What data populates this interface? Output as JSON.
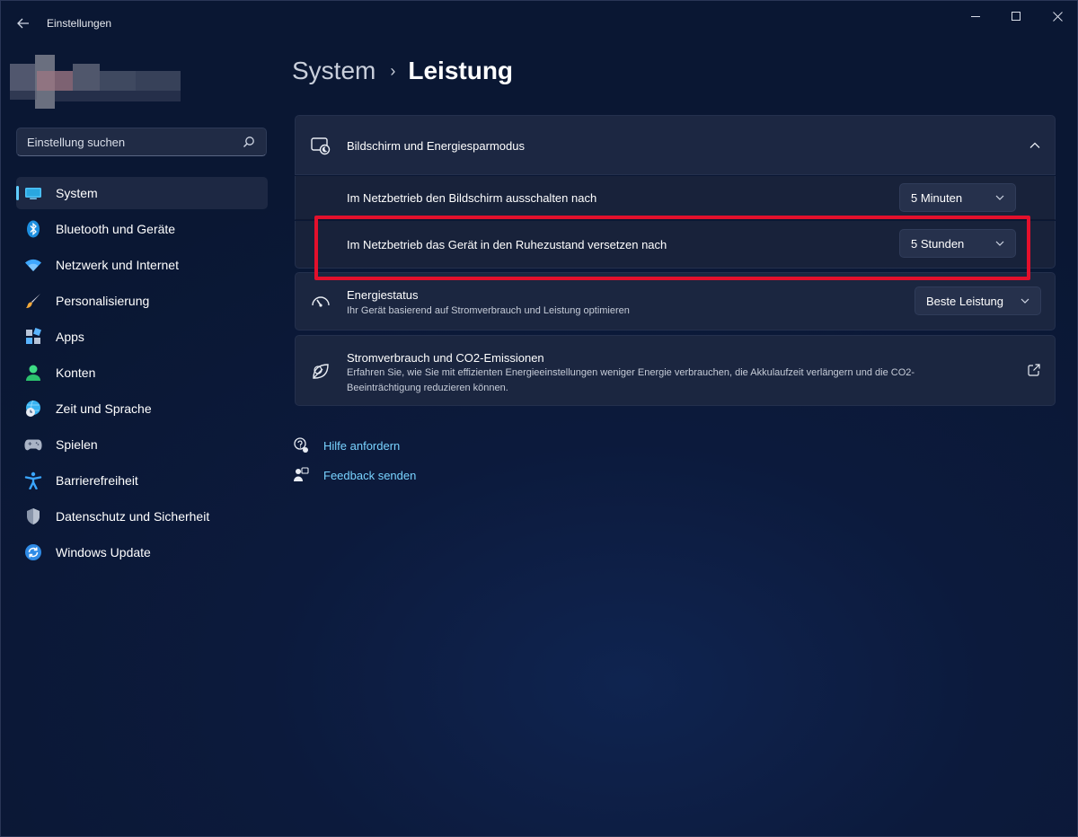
{
  "window": {
    "title": "Einstellungen",
    "back_icon": "back-arrow-icon",
    "controls": [
      "minimize-icon",
      "maximize-icon",
      "close-icon"
    ]
  },
  "search": {
    "placeholder": "Einstellung suchen",
    "icon": "search-icon"
  },
  "sidebar": {
    "items": [
      {
        "label": "System",
        "icon": "monitor-icon",
        "active": true
      },
      {
        "label": "Bluetooth und Geräte",
        "icon": "bluetooth-icon"
      },
      {
        "label": "Netzwerk und Internet",
        "icon": "wifi-icon"
      },
      {
        "label": "Personalisierung",
        "icon": "brush-icon"
      },
      {
        "label": "Apps",
        "icon": "apps-icon"
      },
      {
        "label": "Konten",
        "icon": "account-icon"
      },
      {
        "label": "Zeit und Sprache",
        "icon": "globe-clock-icon"
      },
      {
        "label": "Spielen",
        "icon": "gamepad-icon"
      },
      {
        "label": "Barrierefreiheit",
        "icon": "accessibility-icon"
      },
      {
        "label": "Datenschutz und Sicherheit",
        "icon": "shield-icon"
      },
      {
        "label": "Windows Update",
        "icon": "update-icon"
      }
    ]
  },
  "header": {
    "parent": "System",
    "separator": "›",
    "current": "Leistung"
  },
  "screen_card": {
    "title": "Bildschirm und Energiesparmodus",
    "icon": "screen-sleep-icon",
    "expand_icon": "chevron-up-icon",
    "rows": [
      {
        "label": "Im Netzbetrieb den Bildschirm ausschalten nach",
        "value": "5 Minuten"
      },
      {
        "label": "Im Netzbetrieb das Gerät in den Ruhezustand versetzen nach",
        "value": "5 Stunden"
      }
    ]
  },
  "power_card": {
    "title": "Energiestatus",
    "description": "Ihr Gerät basierend auf Stromverbrauch und Leistung optimieren",
    "value": "Beste Leistung",
    "icon": "gauge-icon"
  },
  "co2_card": {
    "title": "Stromverbrauch und CO2-Emissionen",
    "description_line1": "Erfahren Sie, wie Sie mit effizienten Energieeinstellungen weniger Energie verbrauchen, die Akkulaufzeit verlängern und die CO2-",
    "description_line2": "Beeinträchtigung reduzieren können.",
    "icon": "leaf-icon",
    "link_icon": "open-external-icon"
  },
  "links": [
    {
      "label": "Hilfe anfordern",
      "icon": "help-icon"
    },
    {
      "label": "Feedback senden",
      "icon": "feedback-icon"
    }
  ],
  "colors": {
    "accent": "#60cdff",
    "highlight": "#e3102c",
    "link": "#79d3ff"
  }
}
